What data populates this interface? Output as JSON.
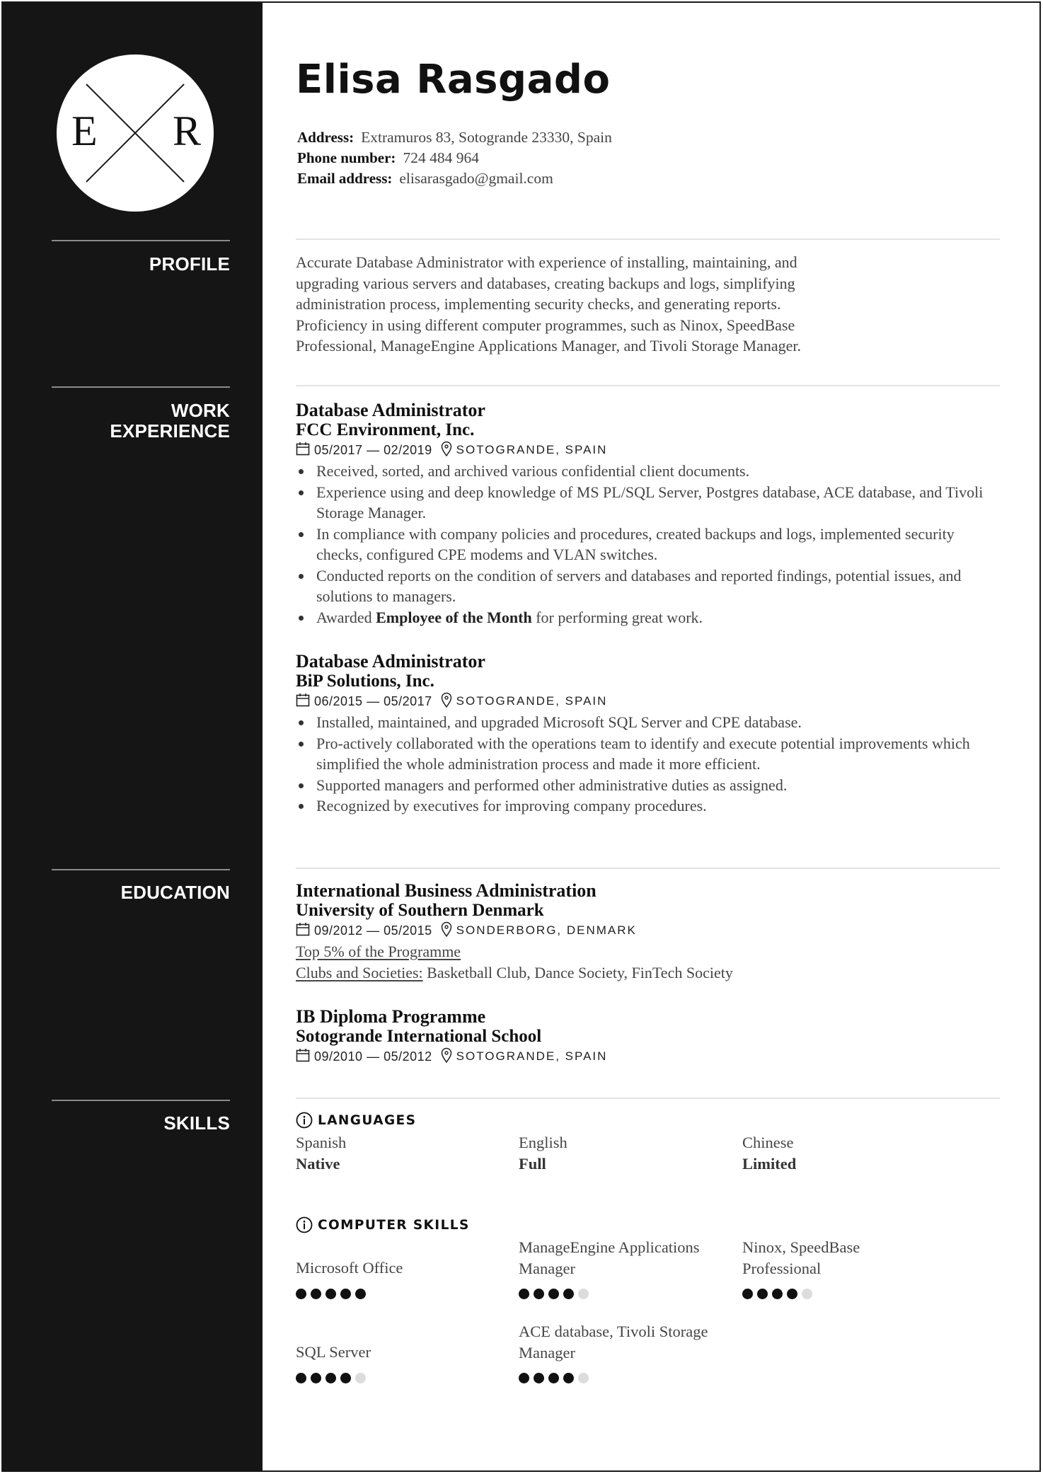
{
  "header": {
    "monogram": {
      "left": "E",
      "right": "R"
    },
    "name": "Elisa Rasgado",
    "contact": [
      {
        "label": "Address:",
        "value": "Extramuros 83, Sotogrande 23330, Spain"
      },
      {
        "label": "Phone number:",
        "value": "724 484 964"
      },
      {
        "label": "Email address:",
        "value": "elisarasgado@gmail.com"
      }
    ]
  },
  "sections": {
    "profile": "PROFILE",
    "work_line1": "WORK",
    "work_line2": "EXPERIENCE",
    "education": "EDUCATION",
    "skills": "SKILLS"
  },
  "profile": {
    "lines": [
      "Accurate Database Administrator with experience of installing, maintaining, and",
      "upgrading various servers and databases, creating backups and logs, simplifying",
      "administration process, implementing security checks, and generating reports.",
      "Proficiency in using different computer programmes, such as Ninox, SpeedBase",
      "Professional, ManageEngine Applications Manager, and Tivoli Storage Manager."
    ]
  },
  "work": [
    {
      "title": "Database Administrator",
      "company": "FCC Environment, Inc.",
      "dates": "05/2017 — 02/2019",
      "location": "SOTOGRANDE, SPAIN",
      "bullets": [
        {
          "text": "Received, sorted, and archived various confidential client documents."
        },
        {
          "text": "Experience using and deep knowledge of MS PL/SQL Server, Postgres database, ACE database, and Tivoli Storage Manager."
        },
        {
          "text": "In compliance with company policies and procedures, created backups and logs, implemented security checks, configured CPE modems and VLAN switches."
        },
        {
          "text": "Conducted reports on the condition of servers and databases and reported findings, potential issues, and solutions to managers."
        },
        {
          "pre": "Awarded ",
          "bold": "Employee of the Month",
          "post": " for performing great work."
        }
      ]
    },
    {
      "title": "Database Administrator",
      "company": "BiP Solutions, Inc.",
      "dates": "06/2015 — 05/2017",
      "location": "SOTOGRANDE, SPAIN",
      "bullets": [
        {
          "text": "Installed, maintained, and upgraded Microsoft SQL Server and CPE database."
        },
        {
          "text": "Pro-actively collaborated with the operations team to identify and execute potential improvements which simplified the whole administration process and made it more efficient."
        },
        {
          "text": "Supported managers and performed other administrative duties as assigned."
        },
        {
          "text": "Recognized by executives for improving company procedures."
        }
      ]
    }
  ],
  "education": [
    {
      "degree": "International Business Administration",
      "school": "University of Southern Denmark",
      "dates": "09/2012 — 05/2015",
      "location": "SONDERBORG, DENMARK",
      "honor": "Top 5% of the Programme",
      "clubs_label": "Clubs and Societies:",
      "clubs": " Basketball Club, Dance Society, FinTech Society"
    },
    {
      "degree": "IB Diploma Programme",
      "school": "Sotogrande International School",
      "dates": "09/2010 — 05/2012",
      "location": "SOTOGRANDE, SPAIN"
    }
  ],
  "skills": {
    "languages_heading": "LANGUAGES",
    "languages": [
      {
        "name": "Spanish",
        "level": "Native"
      },
      {
        "name": "English",
        "level": "Full"
      },
      {
        "name": "Chinese",
        "level": "Limited"
      }
    ],
    "computer_heading": "COMPUTER SKILLS",
    "computer": [
      {
        "name": "Microsoft Office",
        "rating": 5,
        "max": 5
      },
      {
        "name": "ManageEngine Applications Manager",
        "rating": 4,
        "max": 5
      },
      {
        "name": "Ninox, SpeedBase Professional",
        "rating": 4,
        "max": 5
      },
      {
        "name": "SQL Server",
        "rating": 4,
        "max": 5
      },
      {
        "name": "ACE database, Tivoli Storage Manager",
        "rating": 4,
        "max": 5
      }
    ]
  }
}
